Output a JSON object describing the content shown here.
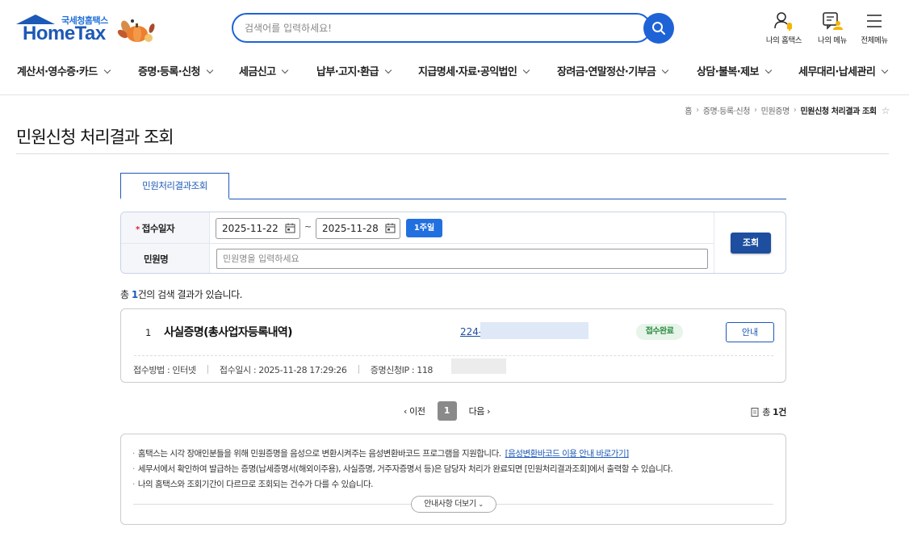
{
  "header": {
    "logo_small": "국세청홈택스",
    "logo_big": "HomeTax",
    "search_placeholder": "검색어를 입력하세요!",
    "util": [
      "나의 홈택스",
      "나의 메뉴",
      "전체메뉴"
    ],
    "brand_color": "#1d59b6",
    "accent_color": "#1e63d6"
  },
  "gnb": [
    "계산서·영수증·카드",
    "증명·등록·신청",
    "세금신고",
    "납부·고지·환급",
    "지급명세·자료·공익법인",
    "장려금·연말정산·기부금",
    "상담·불복·제보",
    "세무대리·납세관리"
  ],
  "breadcrumb": [
    "홈",
    "증명·등록·신청",
    "민원증명",
    "민원신청 처리결과 조회"
  ],
  "page_title": "민원신청 처리결과 조회",
  "tab_label": "민원처리결과조회",
  "form": {
    "date_label": "접수일자",
    "required_mark": "*",
    "date_from": "2025-11-22",
    "date_to": "2025-11-28",
    "tilde": "~",
    "week_button": "1주일",
    "name_label": "민원명",
    "name_placeholder": "민원명을 입력하세요",
    "query_button": "조회"
  },
  "result": {
    "prefix": "총 ",
    "count": "1",
    "suffix": "건의 검색 결과가 있습니다."
  },
  "card": {
    "no": "1",
    "title": "사실증명(총사업자등록내역)",
    "number_prefix": "224-",
    "status": "접수완료",
    "guide_button": "안내",
    "method": "접수방법 : 인터넷",
    "datetime": "접수일시 : 2025-11-28 17:29:26",
    "ip": "증명신청IP : 118"
  },
  "pager": {
    "prev": "이전",
    "page": "1",
    "next": "다음",
    "total_prefix": "총 ",
    "total": "1건"
  },
  "notice": {
    "line1": "홈택스는 시각 장애인분들을 위해 민원증명을 음성으로 변환시켜주는 음성변환바코드 프로그램을 지원합니다.",
    "line1_link": "[음성변환바코드 이용 안내 바로가기]",
    "line2": "세무서에서 확인하여 발급하는 증명(납세증명서(해외이주용), 사실증명, 거주자증명서 등)은 담당자 처리가 완료되면 [민원처리결과조회]에서 출력할 수 있습니다.",
    "line3": "나의 홈택스와 조회기간이 다르므로 조회되는 건수가 다를 수 있습니다.",
    "more_button": "안내사항 더보기"
  }
}
